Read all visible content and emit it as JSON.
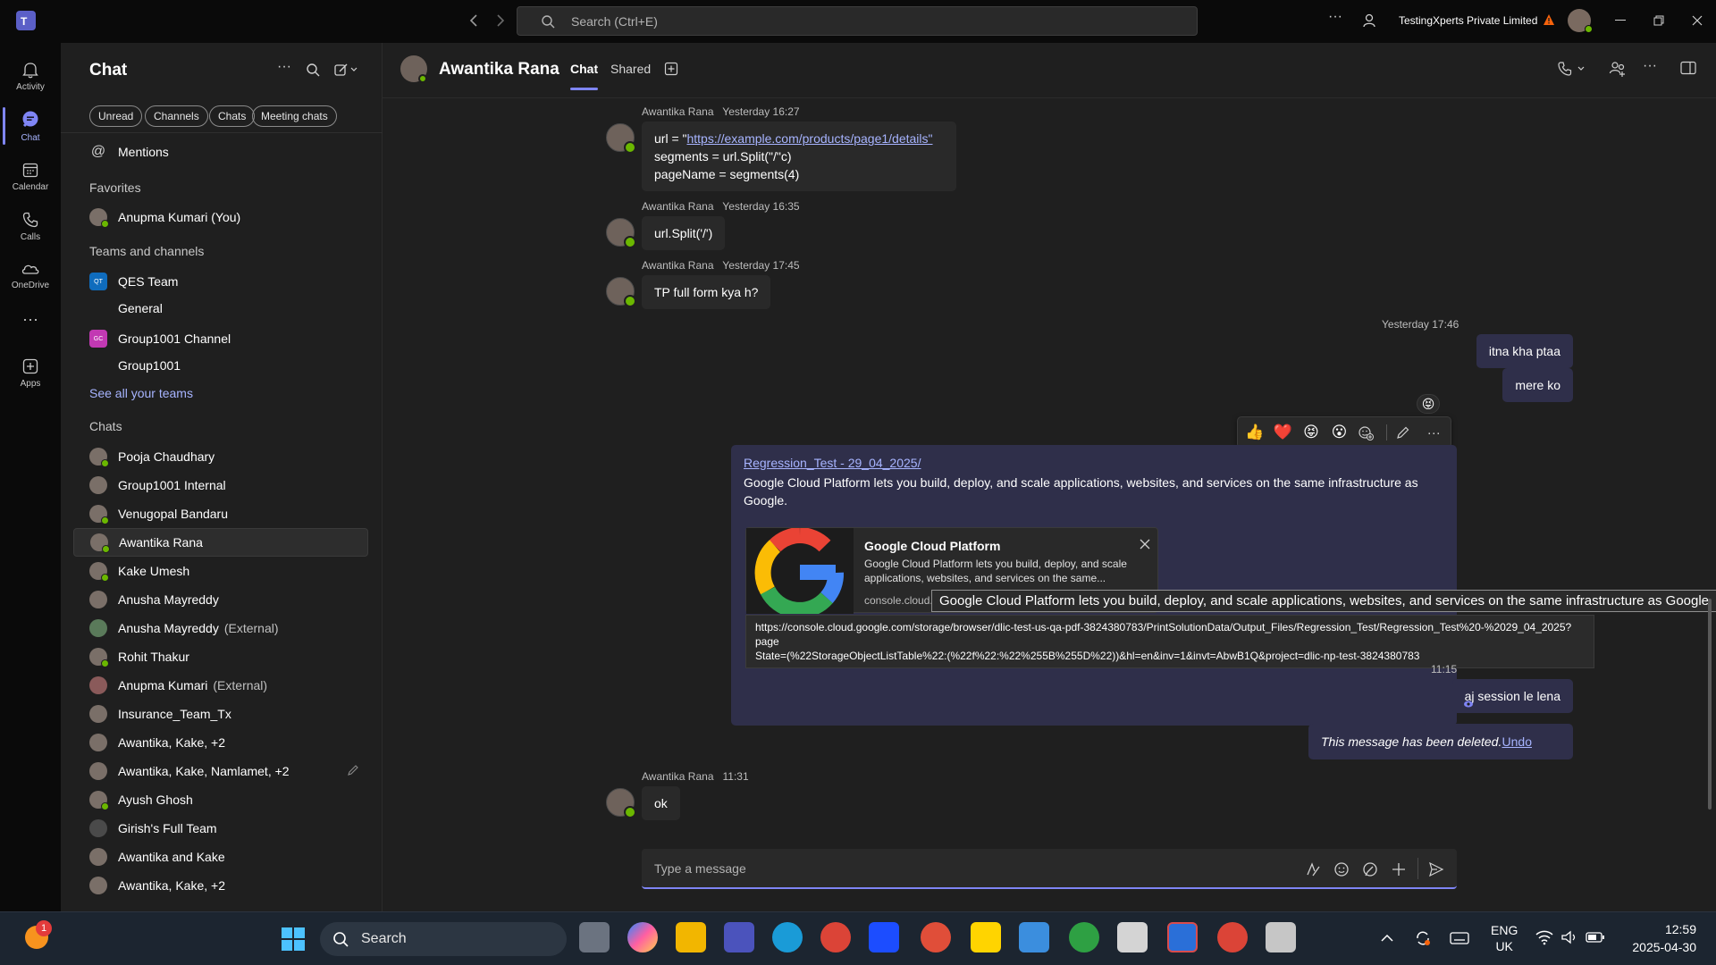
{
  "titlebar": {
    "search_placeholder": "Search (Ctrl+E)",
    "org_name": "TestingXperts Private Limited"
  },
  "rail": {
    "items": [
      {
        "label": "Activity",
        "icon": "bell-icon"
      },
      {
        "label": "Chat",
        "icon": "chat-icon"
      },
      {
        "label": "Calendar",
        "icon": "calendar-icon"
      },
      {
        "label": "Calls",
        "icon": "phone-icon"
      },
      {
        "label": "OneDrive",
        "icon": "cloud-icon"
      },
      {
        "label": "Apps",
        "icon": "plus-box-icon"
      }
    ],
    "more_label": "···"
  },
  "chatlist": {
    "title": "Chat",
    "filters": [
      "Unread",
      "Channels",
      "Chats",
      "Meeting chats"
    ],
    "mentions_label": "Mentions",
    "favorites_header": "Favorites",
    "favorites": [
      {
        "name": "Anupma Kumari (You)"
      }
    ],
    "teams_header": "Teams and channels",
    "teams": [
      {
        "name": "QES Team",
        "badge": "QT",
        "color": "#0f6cbd"
      },
      {
        "name": "General",
        "channel": true
      },
      {
        "name": "Group1001 Channel",
        "badge": "GC",
        "color": "#c239b3"
      },
      {
        "name": "Group1001",
        "channel": true
      }
    ],
    "see_all_teams": "See all your teams",
    "chats_header": "Chats",
    "chats": [
      {
        "name": "Pooja Chaudhary",
        "ext": ""
      },
      {
        "name": "Group1001 Internal",
        "ext": ""
      },
      {
        "name": "Venugopal Bandaru",
        "ext": ""
      },
      {
        "name": "Awantika Rana",
        "ext": "",
        "active": true
      },
      {
        "name": "Kake Umesh",
        "ext": ""
      },
      {
        "name": "Anusha Mayreddy",
        "ext": ""
      },
      {
        "name": "Anusha Mayreddy",
        "ext": "(External)"
      },
      {
        "name": "Rohit Thakur",
        "ext": ""
      },
      {
        "name": "Anupma Kumari",
        "ext": "(External)"
      },
      {
        "name": "Insurance_Team_Tx",
        "ext": ""
      },
      {
        "name": "Awantika, Kake, +2",
        "ext": ""
      },
      {
        "name": "Awantika, Kake, Namlamet, +2",
        "ext": ""
      },
      {
        "name": "Ayush Ghosh",
        "ext": ""
      },
      {
        "name": "Girish's Full Team",
        "ext": ""
      },
      {
        "name": "Awantika and Kake",
        "ext": ""
      },
      {
        "name": "Awantika, Kake, +2",
        "ext": ""
      }
    ]
  },
  "conversation": {
    "contact_name": "Awantika Rana",
    "tabs": [
      "Chat",
      "Shared"
    ],
    "messages": [
      {
        "sender": "Awantika Rana",
        "time": "Yesterday 16:27",
        "line1_prefix": "url = \"",
        "line1_link": "https://example.com/products/page1/details\"",
        "line2": "segments = url.Split(\"/\"c)",
        "line3": "pageName = segments(4)"
      },
      {
        "sender": "Awantika Rana",
        "time": "Yesterday 16:35",
        "text": "url.Split('/')"
      },
      {
        "sender": "Awantika Rana",
        "time": "Yesterday 17:45",
        "text": "TP full form kya h?"
      },
      {
        "time": "Yesterday 17:46",
        "text": "itna kha ptaa"
      },
      {
        "text": "mere ko",
        "reaction": "😝"
      },
      {
        "link": "Regression_Test - 29_04_2025/",
        "text_line1": "Google Cloud Platform lets you build, deploy, and scale applications, websites, and services on the same infrastructure as",
        "text_line2": "Google."
      },
      {
        "time": "11:15",
        "text": "aj session le lena"
      },
      {
        "deleted": "This message has been deleted.",
        "undo": "Undo"
      },
      {
        "sender": "Awantika Rana",
        "time": "11:31",
        "text": "ok"
      }
    ],
    "reactions": [
      "👍",
      "❤️",
      "😝",
      "😮"
    ],
    "preview_card": {
      "title": "Google Cloud Platform",
      "desc_line1": "Google Cloud Platform lets you build, deploy, and scale",
      "desc_line2": "applications, websites, and services on the same...",
      "domain": "console.cloud."
    },
    "tooltip": "Google Cloud Platform lets you build, deploy, and scale applications, websites, and services on the same infrastructure as Google.",
    "url_tooltip_line1": "https://console.cloud.google.com/storage/browser/dlic-test-us-qa-pdf-3824380783/PrintSolutionData/Output_Files/Regression_Test/Regression_Test%20-%2029_04_2025?page",
    "url_tooltip_line2": "State=(%22StorageObjectListTable%22:(%22f%22:%22%255B%255D%22))&hl=en&inv=1&invt=AbwB1Q&project=dlic-np-test-3824380783",
    "composer_placeholder": "Type a message"
  },
  "taskbar": {
    "search_label": "Search",
    "lang_line1": "ENG",
    "lang_line2": "UK",
    "time": "12:59",
    "date": "2025-04-30",
    "notification_count": "1"
  }
}
